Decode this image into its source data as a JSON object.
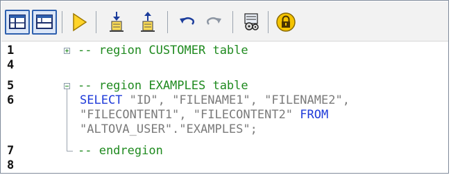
{
  "toolbar": {
    "buttons": [
      {
        "icon": "split-vertical-icon",
        "toggled": true
      },
      {
        "icon": "split-horizontal-icon",
        "toggled": true
      },
      {
        "icon": "execute-icon",
        "toggled": false
      },
      {
        "icon": "import-icon",
        "toggled": false
      },
      {
        "icon": "export-icon",
        "toggled": false
      },
      {
        "icon": "undo-icon",
        "toggled": false
      },
      {
        "icon": "redo-icon",
        "toggled": false
      },
      {
        "icon": "options-icon",
        "toggled": false
      },
      {
        "icon": "lock-icon",
        "toggled": false
      }
    ]
  },
  "editor": {
    "lines": [
      {
        "number": "1",
        "fold": "plus",
        "text": "-- region CUSTOMER table"
      },
      {
        "number": "4"
      },
      {
        "number": "5",
        "fold": "minus",
        "text": "-- region EXAMPLES table"
      },
      {
        "number": "6",
        "select_kw": "SELECT",
        "cols_a": "\"ID\", \"FILENAME1\", \"FILENAME2\",",
        "cols_b": "\"FILECONTENT1\", \"FILECONTENT2\"",
        "from_kw": "FROM",
        "table": "\"ALTOVA_USER\".\"EXAMPLES\";"
      },
      {
        "number": "7",
        "text": "-- endregion"
      },
      {
        "number": "8"
      }
    ]
  },
  "colors": {
    "comment": "#1f8a1f",
    "keyword": "#1e3ad9",
    "string": "#7a7a7a",
    "accent": "#2d5fae"
  }
}
